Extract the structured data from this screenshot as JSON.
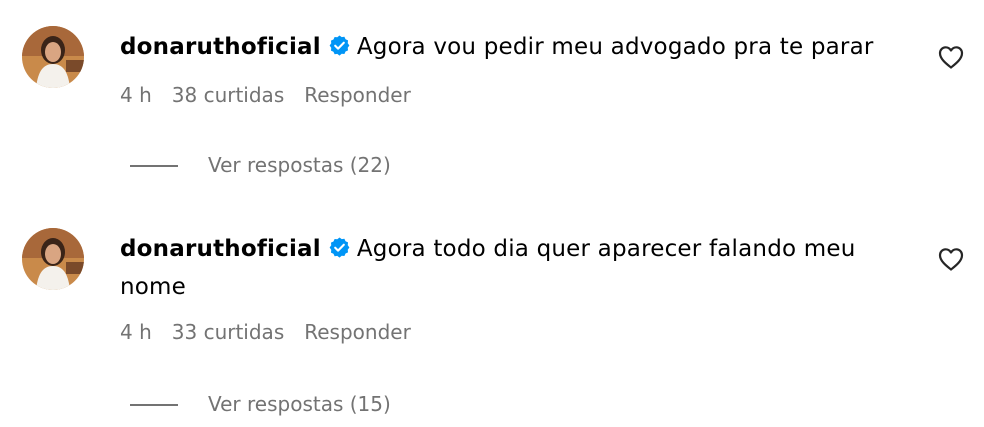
{
  "comments": [
    {
      "username": "donaruthoficial",
      "verified": true,
      "text": "Agora vou pedir meu advogado pra te parar",
      "time": "4 h",
      "likes": "38 curtidas",
      "reply_label": "Responder",
      "view_replies": "Ver respostas (22)"
    },
    {
      "username": "donaruthoficial",
      "verified": true,
      "text": "Agora todo dia quer aparecer falando meu nome",
      "time": "4 h",
      "likes": "33 curtidas",
      "reply_label": "Responder",
      "view_replies": "Ver respostas (15)"
    }
  ],
  "colors": {
    "text": "#000000",
    "meta": "#737373",
    "verified_badge": "#0095F6",
    "heart_stroke": "#262626"
  },
  "icons": {
    "verified": "verified-badge-icon",
    "like": "heart-outline-icon"
  }
}
